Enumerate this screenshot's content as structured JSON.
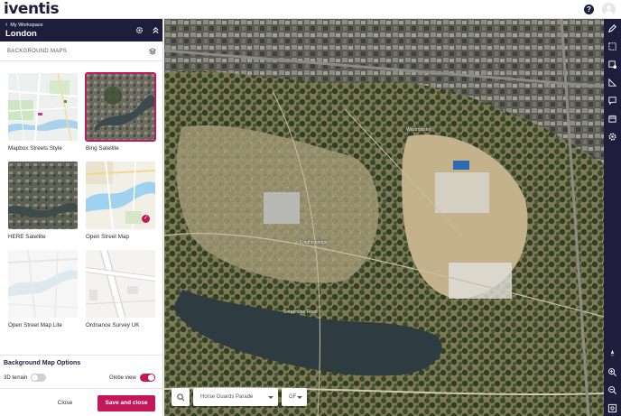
{
  "app": {
    "logo_text": "iventis",
    "help_label": "?"
  },
  "panel": {
    "back_link": "My Workspace",
    "title": "London",
    "section_title": "BACKGROUND MAPS",
    "maps": [
      {
        "label": "Mapbox Streets Style",
        "selected": false,
        "checked": false
      },
      {
        "label": "Bing Satellite",
        "selected": true,
        "checked": false
      },
      {
        "label": "HERE Satellite",
        "selected": false,
        "checked": false
      },
      {
        "label": "Open Street Map",
        "selected": false,
        "checked": true
      },
      {
        "label": "Open Street Map Lite",
        "selected": false,
        "checked": false
      },
      {
        "label": "Ordnance Survey UK",
        "selected": false,
        "checked": false
      }
    ],
    "options_title": "Background Map Options",
    "terrain_label": "3D terrain",
    "terrain_on": false,
    "globe_label": "Globe view",
    "globe_on": true,
    "close_label": "Close",
    "save_label": "Save and close"
  },
  "map": {
    "labels": {
      "westminster": "Westminster",
      "road_north": "Knightsbridge",
      "road_mid": "Serpentine Road",
      "road_lake": "Serpentine Road"
    },
    "search": {
      "location_value": "Horse Guards Parade",
      "level_value": "GF"
    }
  },
  "colors": {
    "brand_navy": "#1f1d3c",
    "accent_pink": "#c2185b"
  }
}
